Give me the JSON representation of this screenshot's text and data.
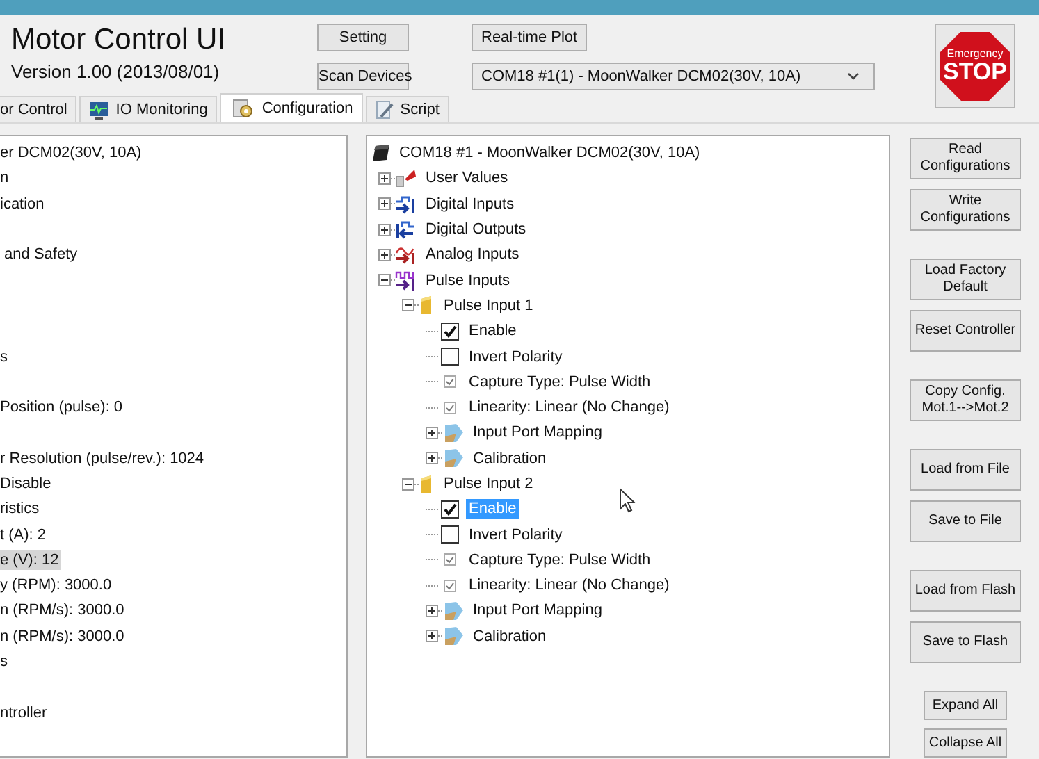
{
  "header": {
    "title": "Motor Control UI",
    "version": "Version 1.00 (2013/08/01)"
  },
  "toolbar": {
    "setting": "Setting",
    "scan": "Scan Devices",
    "plot": "Real-time Plot"
  },
  "device_select": {
    "value": "COM18 #1(1) - MoonWalker DCM02(30V, 10A)"
  },
  "stop_button": {
    "line_1": "Emergency",
    "line_2": "STOP"
  },
  "tabs": [
    {
      "label": "or Control",
      "selected": false
    },
    {
      "label": "IO Monitoring",
      "selected": false
    },
    {
      "label": "Configuration",
      "selected": true
    },
    {
      "label": "Script",
      "selected": false
    }
  ],
  "left_list": {
    "rows": [
      {
        "kind": "text",
        "text": "er DCM02(30V, 10A)",
        "selected": false
      },
      {
        "kind": "text",
        "text": "n",
        "selected": false
      },
      {
        "kind": "text",
        "text": "ication",
        "selected": false
      },
      {
        "kind": "offscreen"
      },
      {
        "kind": "text",
        "text": " and Safety",
        "selected": false
      },
      {
        "kind": "offscreen"
      },
      {
        "kind": "offscreen"
      },
      {
        "kind": "offscreen"
      },
      {
        "kind": "text",
        "text": "s",
        "selected": false
      },
      {
        "kind": "offscreen"
      },
      {
        "kind": "text",
        "text": "Position (pulse): 0",
        "selected": false
      },
      {
        "kind": "offscreen"
      },
      {
        "kind": "text",
        "text": "r Resolution (pulse/rev.): 1024",
        "selected": false
      },
      {
        "kind": "text",
        "text": "Disable",
        "selected": false
      },
      {
        "kind": "text",
        "text": "ristics",
        "selected": false
      },
      {
        "kind": "text",
        "text": "t (A): 2",
        "selected": false
      },
      {
        "kind": "text",
        "text": "e (V): 12",
        "selected": true
      },
      {
        "kind": "text",
        "text": "y (RPM): 3000.0",
        "selected": false
      },
      {
        "kind": "text",
        "text": "n (RPM/s): 3000.0",
        "selected": false
      },
      {
        "kind": "text",
        "text": "n (RPM/s): 3000.0",
        "selected": false
      },
      {
        "kind": "text",
        "text": "s",
        "selected": false
      },
      {
        "kind": "offscreen"
      },
      {
        "kind": "text",
        "text": "ntroller",
        "selected": false
      }
    ]
  },
  "tree": {
    "kind": "device",
    "label": "COM18 #1 - MoonWalker DCM02(30V, 10A)",
    "selected": false,
    "children": [
      {
        "kind": "group",
        "label": "User Values",
        "expanded": false,
        "selected": false
      },
      {
        "kind": "group",
        "label": "Digital Inputs",
        "expanded": false,
        "selected": false
      },
      {
        "kind": "group",
        "label": "Digital Outputs",
        "expanded": false,
        "selected": false
      },
      {
        "kind": "group",
        "label": "Analog Inputs",
        "expanded": false,
        "selected": false
      },
      {
        "kind": "group",
        "label": "Pulse Inputs",
        "expanded": true,
        "selected": false,
        "children": [
          {
            "kind": "folder",
            "label": "Pulse Input 1",
            "expanded": true,
            "selected": false,
            "children": [
              {
                "kind": "option",
                "label": "Enable",
                "checked": true,
                "selected": false
              },
              {
                "kind": "option",
                "label": "Invert Polarity",
                "checked": false,
                "selected": false
              },
              {
                "kind": "setting",
                "label": "Capture Type: Pulse Width",
                "checked": true,
                "selected": false
              },
              {
                "kind": "setting",
                "label": "Linearity: Linear (No Change)",
                "checked": true,
                "selected": false
              },
              {
                "kind": "subgroup",
                "label": "Input Port Mapping",
                "expanded": false,
                "selected": false
              },
              {
                "kind": "subgroup",
                "label": "Calibration",
                "expanded": false,
                "selected": false
              }
            ]
          },
          {
            "kind": "folder",
            "label": "Pulse Input 2",
            "expanded": true,
            "selected": false,
            "children": [
              {
                "kind": "option",
                "label": "Enable",
                "checked": true,
                "selected": true
              },
              {
                "kind": "option",
                "label": "Invert Polarity",
                "checked": false,
                "selected": false
              },
              {
                "kind": "setting",
                "label": "Capture Type: Pulse Width",
                "checked": true,
                "selected": false
              },
              {
                "kind": "setting",
                "label": "Linearity: Linear (No Change)",
                "checked": true,
                "selected": false
              },
              {
                "kind": "subgroup",
                "label": "Input Port Mapping",
                "expanded": false,
                "selected": false
              },
              {
                "kind": "subgroup",
                "label": "Calibration",
                "expanded": false,
                "selected": false
              }
            ]
          }
        ]
      }
    ]
  },
  "action_groups": [
    {
      "kind": "large",
      "buttons": [
        "Read Configurations",
        "Write Configurations"
      ]
    },
    {
      "kind": "large",
      "buttons": [
        "Load Factory Default",
        "Reset Controller"
      ]
    },
    {
      "kind": "large",
      "buttons": [
        "Copy Config. Mot.1-->Mot.2"
      ]
    },
    {
      "kind": "large",
      "buttons": [
        "Load from File",
        "Save to File"
      ]
    },
    {
      "kind": "large",
      "buttons": [
        "Load from Flash",
        "Save to Flash"
      ]
    },
    {
      "kind": "small",
      "buttons": [
        "Expand All",
        "Collapse All"
      ]
    }
  ]
}
